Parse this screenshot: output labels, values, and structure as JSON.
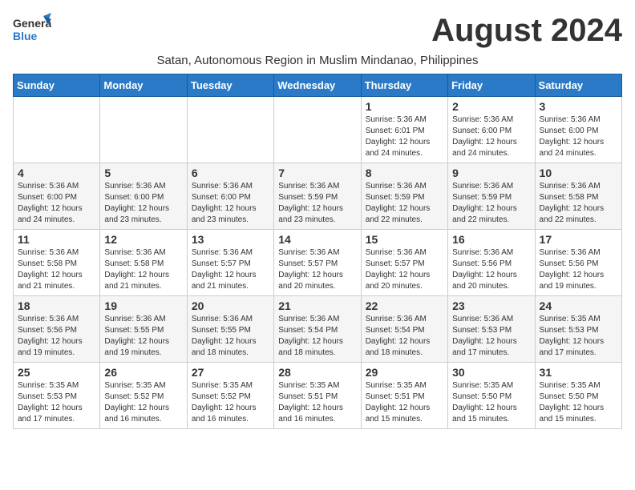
{
  "logo": {
    "general": "General",
    "blue": "Blue"
  },
  "title": "August 2024",
  "subtitle": "Satan, Autonomous Region in Muslim Mindanao, Philippines",
  "header": {
    "days": [
      "Sunday",
      "Monday",
      "Tuesday",
      "Wednesday",
      "Thursday",
      "Friday",
      "Saturday"
    ]
  },
  "weeks": [
    [
      {
        "day": "",
        "info": ""
      },
      {
        "day": "",
        "info": ""
      },
      {
        "day": "",
        "info": ""
      },
      {
        "day": "",
        "info": ""
      },
      {
        "day": "1",
        "info": "Sunrise: 5:36 AM\nSunset: 6:01 PM\nDaylight: 12 hours\nand 24 minutes."
      },
      {
        "day": "2",
        "info": "Sunrise: 5:36 AM\nSunset: 6:00 PM\nDaylight: 12 hours\nand 24 minutes."
      },
      {
        "day": "3",
        "info": "Sunrise: 5:36 AM\nSunset: 6:00 PM\nDaylight: 12 hours\nand 24 minutes."
      }
    ],
    [
      {
        "day": "4",
        "info": "Sunrise: 5:36 AM\nSunset: 6:00 PM\nDaylight: 12 hours\nand 24 minutes."
      },
      {
        "day": "5",
        "info": "Sunrise: 5:36 AM\nSunset: 6:00 PM\nDaylight: 12 hours\nand 23 minutes."
      },
      {
        "day": "6",
        "info": "Sunrise: 5:36 AM\nSunset: 6:00 PM\nDaylight: 12 hours\nand 23 minutes."
      },
      {
        "day": "7",
        "info": "Sunrise: 5:36 AM\nSunset: 5:59 PM\nDaylight: 12 hours\nand 23 minutes."
      },
      {
        "day": "8",
        "info": "Sunrise: 5:36 AM\nSunset: 5:59 PM\nDaylight: 12 hours\nand 22 minutes."
      },
      {
        "day": "9",
        "info": "Sunrise: 5:36 AM\nSunset: 5:59 PM\nDaylight: 12 hours\nand 22 minutes."
      },
      {
        "day": "10",
        "info": "Sunrise: 5:36 AM\nSunset: 5:58 PM\nDaylight: 12 hours\nand 22 minutes."
      }
    ],
    [
      {
        "day": "11",
        "info": "Sunrise: 5:36 AM\nSunset: 5:58 PM\nDaylight: 12 hours\nand 21 minutes."
      },
      {
        "day": "12",
        "info": "Sunrise: 5:36 AM\nSunset: 5:58 PM\nDaylight: 12 hours\nand 21 minutes."
      },
      {
        "day": "13",
        "info": "Sunrise: 5:36 AM\nSunset: 5:57 PM\nDaylight: 12 hours\nand 21 minutes."
      },
      {
        "day": "14",
        "info": "Sunrise: 5:36 AM\nSunset: 5:57 PM\nDaylight: 12 hours\nand 20 minutes."
      },
      {
        "day": "15",
        "info": "Sunrise: 5:36 AM\nSunset: 5:57 PM\nDaylight: 12 hours\nand 20 minutes."
      },
      {
        "day": "16",
        "info": "Sunrise: 5:36 AM\nSunset: 5:56 PM\nDaylight: 12 hours\nand 20 minutes."
      },
      {
        "day": "17",
        "info": "Sunrise: 5:36 AM\nSunset: 5:56 PM\nDaylight: 12 hours\nand 19 minutes."
      }
    ],
    [
      {
        "day": "18",
        "info": "Sunrise: 5:36 AM\nSunset: 5:56 PM\nDaylight: 12 hours\nand 19 minutes."
      },
      {
        "day": "19",
        "info": "Sunrise: 5:36 AM\nSunset: 5:55 PM\nDaylight: 12 hours\nand 19 minutes."
      },
      {
        "day": "20",
        "info": "Sunrise: 5:36 AM\nSunset: 5:55 PM\nDaylight: 12 hours\nand 18 minutes."
      },
      {
        "day": "21",
        "info": "Sunrise: 5:36 AM\nSunset: 5:54 PM\nDaylight: 12 hours\nand 18 minutes."
      },
      {
        "day": "22",
        "info": "Sunrise: 5:36 AM\nSunset: 5:54 PM\nDaylight: 12 hours\nand 18 minutes."
      },
      {
        "day": "23",
        "info": "Sunrise: 5:36 AM\nSunset: 5:53 PM\nDaylight: 12 hours\nand 17 minutes."
      },
      {
        "day": "24",
        "info": "Sunrise: 5:35 AM\nSunset: 5:53 PM\nDaylight: 12 hours\nand 17 minutes."
      }
    ],
    [
      {
        "day": "25",
        "info": "Sunrise: 5:35 AM\nSunset: 5:53 PM\nDaylight: 12 hours\nand 17 minutes."
      },
      {
        "day": "26",
        "info": "Sunrise: 5:35 AM\nSunset: 5:52 PM\nDaylight: 12 hours\nand 16 minutes."
      },
      {
        "day": "27",
        "info": "Sunrise: 5:35 AM\nSunset: 5:52 PM\nDaylight: 12 hours\nand 16 minutes."
      },
      {
        "day": "28",
        "info": "Sunrise: 5:35 AM\nSunset: 5:51 PM\nDaylight: 12 hours\nand 16 minutes."
      },
      {
        "day": "29",
        "info": "Sunrise: 5:35 AM\nSunset: 5:51 PM\nDaylight: 12 hours\nand 15 minutes."
      },
      {
        "day": "30",
        "info": "Sunrise: 5:35 AM\nSunset: 5:50 PM\nDaylight: 12 hours\nand 15 minutes."
      },
      {
        "day": "31",
        "info": "Sunrise: 5:35 AM\nSunset: 5:50 PM\nDaylight: 12 hours\nand 15 minutes."
      }
    ]
  ]
}
